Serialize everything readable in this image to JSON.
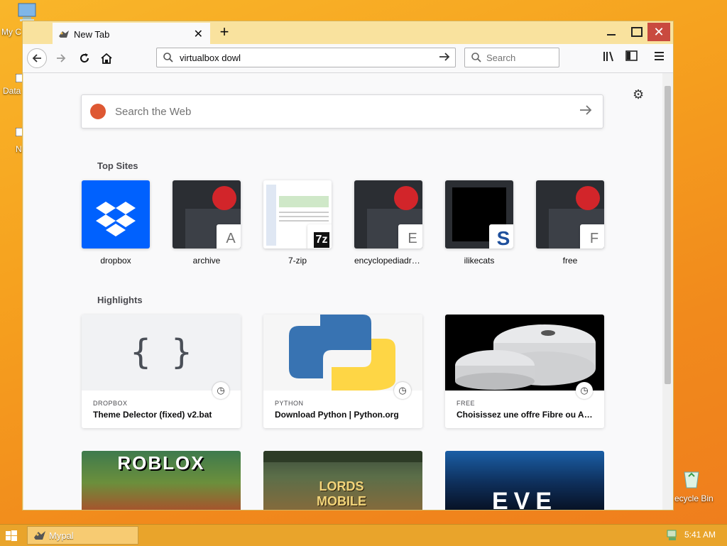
{
  "desktop": {
    "icon_labels": [
      "My C",
      "Data",
      "N"
    ],
    "recycle_bin_label": "ecycle Bin"
  },
  "browser": {
    "tab_title": "New Tab",
    "new_tab_symbol": "+",
    "url_value": "virtualbox dowl",
    "search_placeholder": "Search"
  },
  "newtab": {
    "web_search_placeholder": "Search the Web",
    "top_sites_title": "Top Sites",
    "top_sites": [
      {
        "label": "dropbox",
        "badge": ""
      },
      {
        "label": "archive",
        "badge": "A"
      },
      {
        "label": "7-zip",
        "badge": "7z"
      },
      {
        "label": "encyclopediadra...",
        "badge": "E"
      },
      {
        "label": "ilikecats",
        "badge": "S"
      },
      {
        "label": "free",
        "badge": "F"
      }
    ],
    "highlights_title": "Highlights",
    "highlights": [
      {
        "context": "DROPBOX",
        "title": "Theme Delector (fixed) v2.bat",
        "image_text": "{ }"
      },
      {
        "context": "PYTHON",
        "title": "Download Python | Python.org",
        "image_text": ""
      },
      {
        "context": "FREE",
        "title": "Choisissez une offre Fibre ou AD...",
        "image_text": ""
      },
      {
        "context": "",
        "title": "",
        "image_text": "ROBLOX"
      },
      {
        "context": "",
        "title": "",
        "image_text": "LORDS MOBILE"
      },
      {
        "context": "",
        "title": "",
        "image_text": "EVE"
      }
    ]
  },
  "taskbar": {
    "app_label": "Mypal",
    "time": "5:41 AM"
  },
  "colors": {
    "dropbox_blue": "#0061fe",
    "close_red": "#c94a3f"
  }
}
